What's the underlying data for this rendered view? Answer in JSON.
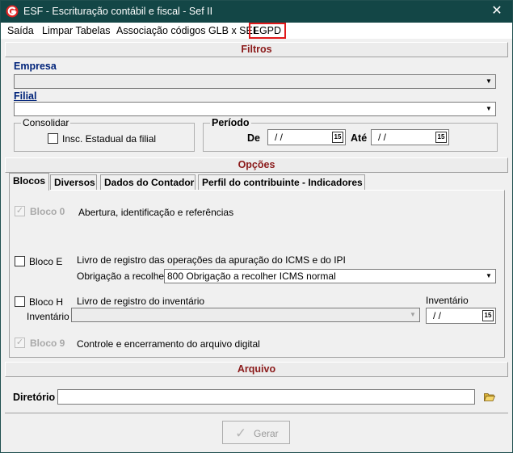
{
  "window": {
    "title": "ESF - Escrituração contábil e fiscal - Sef II",
    "close_glyph": "✕"
  },
  "menu": {
    "items": [
      "Saída",
      "Limpar Tabelas",
      "Associação códigos GLB x SEF",
      "LGPD"
    ]
  },
  "filtros": {
    "header": "Filtros",
    "empresa_label": "Empresa",
    "empresa_value": "",
    "filial_label": "Filial",
    "filial_value": "",
    "consolidar_title": "Consolidar",
    "insc_label": "Insc. Estadual da filial",
    "periodo_title": "Período",
    "de_label": "De",
    "de_value": "/ /",
    "ate_label": "Até",
    "ate_value": "/ /"
  },
  "opcoes": {
    "header": "Opções",
    "tabs": [
      "Blocos",
      "Diversos",
      "Dados do Contador",
      "Perfil do contribuinte - Indicadores"
    ],
    "bloco0_label": "Bloco 0",
    "bloco0_desc": "Abertura, identificação e referências",
    "blocoE_label": "Bloco E",
    "blocoE_desc": "Livro de registro das operações da apuração do ICMS e do IPI",
    "obrigacao_label": "Obrigação a recolher",
    "obrigacao_value": "800 Obrigação a recolher ICMS normal",
    "blocoH_label": "Bloco H",
    "blocoH_desc": "Livro de registro do inventário",
    "inventario_label": "Inventário",
    "inventario_date_label": "Inventário",
    "inventario_date_value": "/ /",
    "bloco9_label": "Bloco 9",
    "bloco9_desc": "Controle e encerramento do arquivo digital"
  },
  "arquivo": {
    "header": "Arquivo",
    "diretorio_label": "Diretório",
    "diretorio_value": ""
  },
  "actions": {
    "gerar_label": "Gerar"
  },
  "colors": {
    "titlebar": "#134646",
    "header_text": "#8b1a1a",
    "label_blue": "#00237a",
    "highlight_border": "#e0191a"
  }
}
